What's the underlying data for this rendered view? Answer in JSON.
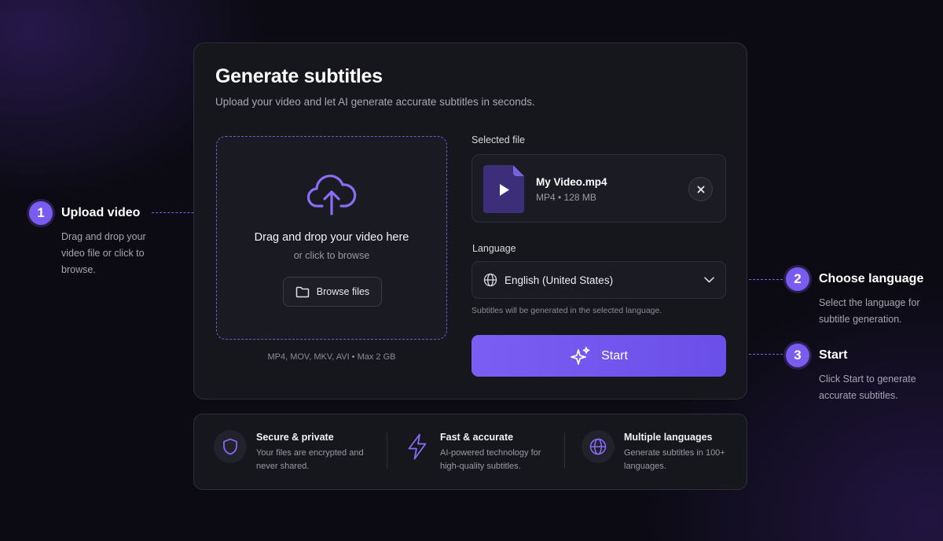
{
  "header": {
    "title": "Generate subtitles",
    "subtitle": "Upload your video and let AI generate accurate subtitles in seconds."
  },
  "dropzone": {
    "title": "Drag and drop your video here",
    "subtitle": "or click to browse",
    "browse_label": "Browse files",
    "formats": "MP4, MOV, MKV, AVI • Max 2 GB"
  },
  "selected_file": {
    "label": "Selected file",
    "name": "My Video.mp4",
    "meta": "MP4 • 128 MB"
  },
  "language": {
    "label": "Language",
    "value": "English (United States)",
    "helper": "Subtitles will be generated in the selected language."
  },
  "start_button": {
    "label": "Start"
  },
  "steps": [
    {
      "number": "1",
      "title": "Upload video",
      "desc_lines": [
        "Drag and drop your",
        "video file or click to",
        "browse."
      ]
    },
    {
      "number": "2",
      "title": "Choose language",
      "desc_lines": [
        "Select the language for",
        "subtitle generation."
      ]
    },
    {
      "number": "3",
      "title": "Start",
      "desc_lines": [
        "Click Start to generate",
        "accurate subtitles."
      ]
    }
  ],
  "features": [
    {
      "title": "Secure & private",
      "desc_lines": [
        "Your files are encrypted and",
        "never shared."
      ],
      "icon": "shield-icon"
    },
    {
      "title": "Fast & accurate",
      "desc_lines": [
        "AI-powered technology for",
        "high-quality subtitles."
      ],
      "icon": "lightning-icon"
    },
    {
      "title": "Multiple languages",
      "desc_lines": [
        "Generate subtitles in 100+",
        "languages."
      ],
      "icon": "globe-icon"
    }
  ],
  "colors": {
    "accent": "#7b5ef3",
    "background": "#0c0b14",
    "card": "#16161d"
  }
}
